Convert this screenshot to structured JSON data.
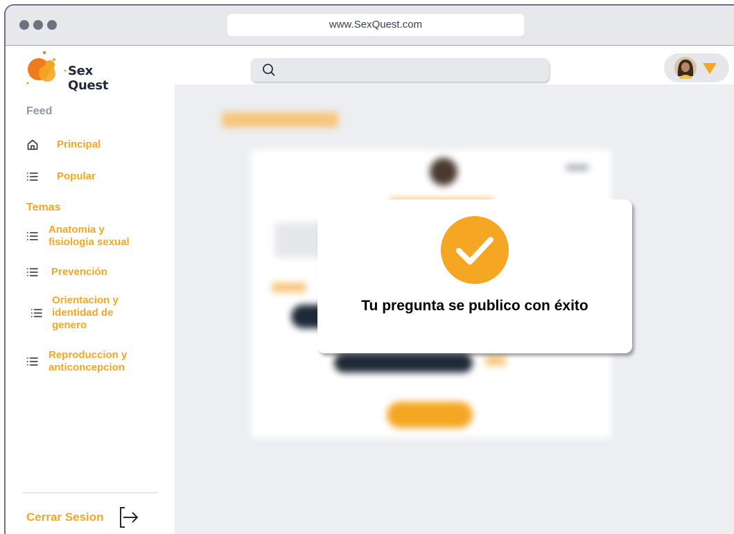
{
  "browser": {
    "url": "www.SexQuest.com"
  },
  "app": {
    "name": "Sex Quest"
  },
  "sidebar": {
    "feed_heading": "Feed",
    "feed_items": [
      {
        "label": "Principal",
        "icon": "home-icon"
      },
      {
        "label": "Popular",
        "icon": "list-icon"
      }
    ],
    "topics_heading": "Temas",
    "topic_items": [
      {
        "label": "Anatomia y fisiologia sexual",
        "icon": "list-icon"
      },
      {
        "label": "Prevención",
        "icon": "list-icon"
      },
      {
        "label": "Orientacion y identidad de genero",
        "icon": "list-icon"
      },
      {
        "label": "Reproduccion y anticoncepcion",
        "icon": "list-icon"
      }
    ],
    "logout_label": "Cerrar Sesion"
  },
  "header": {
    "search_placeholder": "",
    "avatar": "user-avatar"
  },
  "dialog": {
    "icon": "checkmark-icon",
    "message": "Tu pregunta se publico con éxito"
  },
  "colors": {
    "accent": "#f5a623",
    "feed_heading": "#8a9aa6",
    "content_bg": "#eceef1"
  }
}
